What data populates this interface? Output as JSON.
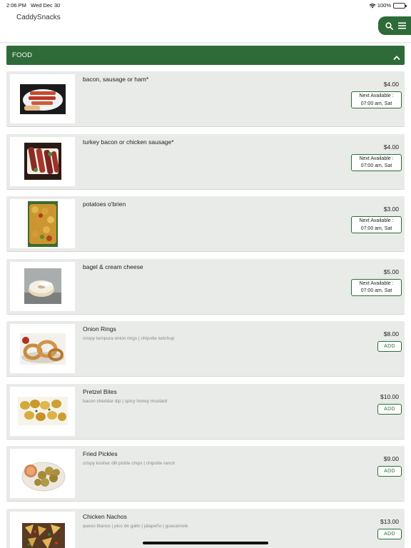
{
  "status_bar": {
    "time": "2:06 PM",
    "date": "Wed Dec 30",
    "battery": "100%"
  },
  "header": {
    "title": "CaddySnacks"
  },
  "section": {
    "title": "FOOD"
  },
  "items": [
    {
      "name": "bacon, sausage or ham*",
      "description": "",
      "price": "$4.00",
      "available_label": "Next Available :",
      "available_time": "07:00 am, Sat",
      "image": "bacon-photo"
    },
    {
      "name": "turkey bacon or chicken sausage*",
      "description": "",
      "price": "$4.00",
      "available_label": "Next Available :",
      "available_time": "07:00 am, Sat",
      "image": "turkey-bacon-photo"
    },
    {
      "name": "potatoes o'brien",
      "description": "",
      "price": "$3.00",
      "available_label": "Next Available :",
      "available_time": "07:00 am, Sat",
      "image": "potatoes-photo"
    },
    {
      "name": "bagel & cream cheese",
      "description": "",
      "price": "$5.00",
      "available_label": "Next Available :",
      "available_time": "07:00 am, Sat",
      "image": "bagel-photo"
    },
    {
      "name": "Onion Rings",
      "description": "crispy tempura onion rings | chipotle ketchup",
      "price": "$8.00",
      "add_label": "ADD",
      "image": "onion-rings-photo"
    },
    {
      "name": "Pretzel Bites",
      "description": "bacon cheddar dip | spicy honey mustard",
      "price": "$10.00",
      "add_label": "ADD",
      "image": "pretzel-bites-photo"
    },
    {
      "name": "Fried Pickles",
      "description": "crispy kosher dill pickle chips | chipotle ranch",
      "price": "$9.00",
      "add_label": "ADD",
      "image": "fried-pickles-photo"
    },
    {
      "name": "Chicken Nachos",
      "description": "queso blanco | pico de gallo | jalapeño | guacamole",
      "price": "$13.00",
      "add_label": "ADD",
      "image": "nachos-photo"
    }
  ],
  "colors": {
    "brand_green": "#2e6b38",
    "card_bg": "#e9ebe8"
  },
  "icons": {
    "search": "search-icon",
    "menu": "hamburger-menu-icon",
    "collapse": "chevron-up-icon"
  }
}
